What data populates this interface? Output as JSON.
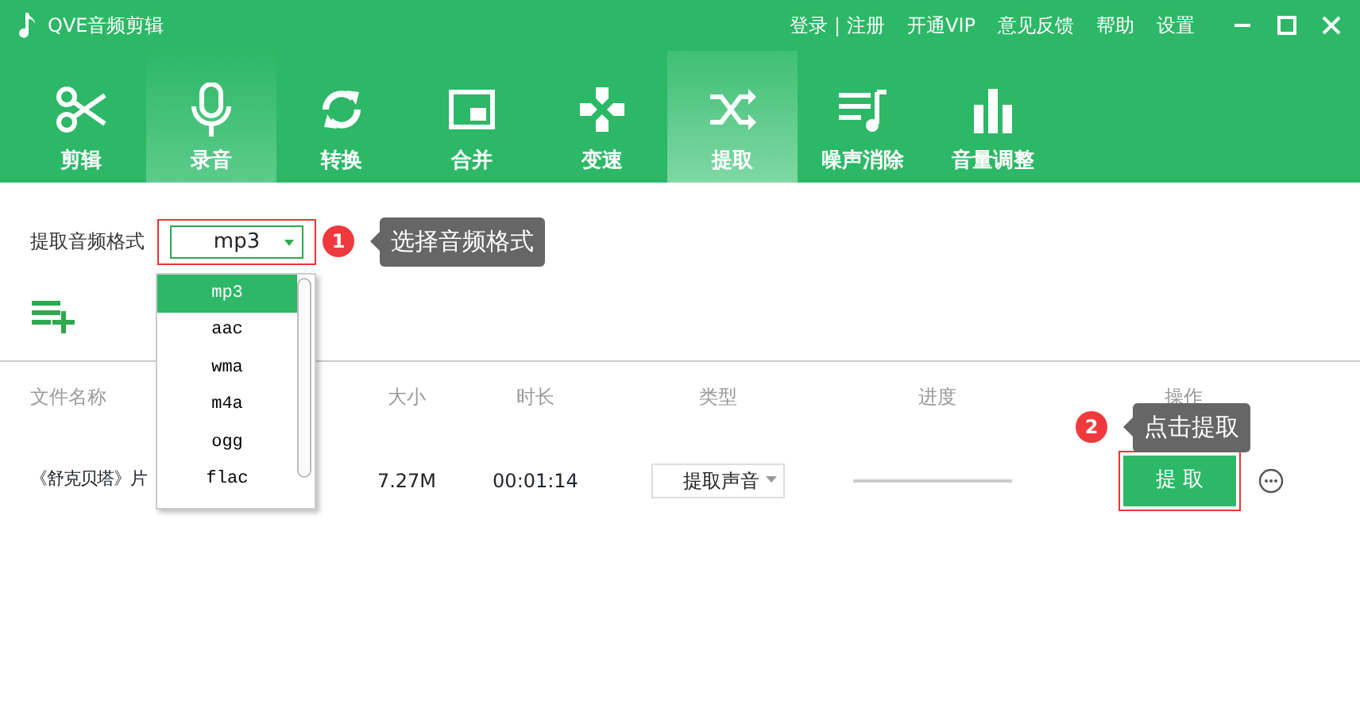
{
  "title_bar": {
    "app_title": "QVE音频剪辑",
    "login": "登录",
    "separator": "|",
    "register": "注册",
    "links": [
      "开通VIP",
      "意见反馈",
      "帮助",
      "设置"
    ]
  },
  "tabs": [
    {
      "kind": "scissors",
      "label": "剪辑",
      "selected": false,
      "hovered": false
    },
    {
      "kind": "mic",
      "label": "录音",
      "selected": false,
      "hovered": true
    },
    {
      "kind": "cycle",
      "label": "转换",
      "selected": false,
      "hovered": false
    },
    {
      "kind": "merge",
      "label": "合并",
      "selected": false,
      "hovered": false
    },
    {
      "kind": "speed",
      "label": "变速",
      "selected": false,
      "hovered": false
    },
    {
      "kind": "shuffle",
      "label": "提取",
      "selected": true,
      "hovered": false
    },
    {
      "kind": "noise",
      "label": "噪声消除",
      "selected": false,
      "hovered": false
    },
    {
      "kind": "bars",
      "label": "音量调整",
      "selected": false,
      "hovered": false
    }
  ],
  "format": {
    "label": "提取音频格式",
    "value": "mp3",
    "options": [
      {
        "label": "mp3",
        "selected": true
      },
      {
        "label": "aac",
        "selected": false
      },
      {
        "label": "wma",
        "selected": false
      },
      {
        "label": "m4a",
        "selected": false
      },
      {
        "label": "ogg",
        "selected": false
      },
      {
        "label": "flac",
        "selected": false
      }
    ]
  },
  "hints": [
    {
      "number": "1",
      "text": "选择音频格式"
    },
    {
      "number": "2",
      "text": "点击提取"
    }
  ],
  "table": {
    "columns": [
      "文件名称",
      "大小",
      "时长",
      "类型",
      "进度",
      "操作"
    ],
    "rows": [
      {
        "name": "《舒克贝塔》片",
        "size": "7.27M",
        "duration": "00:01:14",
        "type": "提取声音",
        "level": 0,
        "action": "提 取"
      }
    ]
  }
}
